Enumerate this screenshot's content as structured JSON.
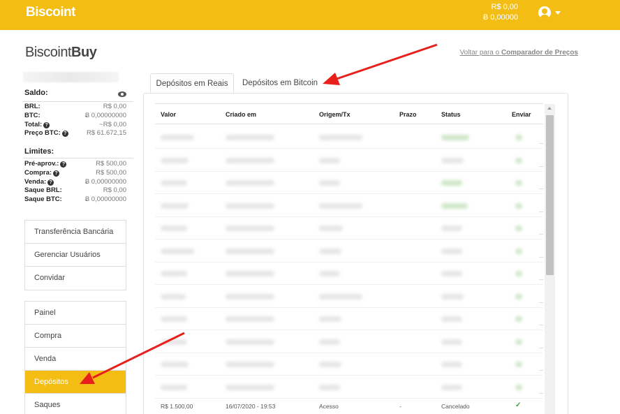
{
  "topbar": {
    "logo": "Biscoint",
    "balance_brl": "R$ 0,00",
    "balance_btc": "Ƀ 0,00000"
  },
  "header": {
    "brand_light": "Biscoint",
    "brand_bold": "Buy",
    "back_link_prefix": "Voltar para o ",
    "back_link_bold": "Comparador de Preços"
  },
  "sidebar": {
    "saldo_title": "Saldo:",
    "saldo": [
      {
        "label": "BRL:",
        "value": "R$ 0,00",
        "help": false
      },
      {
        "label": "BTC:",
        "value": "Ƀ 0,00000000",
        "help": false
      },
      {
        "label": "Total:",
        "value": "~R$ 0,00",
        "help": true
      },
      {
        "label": "Preço BTC:",
        "value": "R$ 61.672,15",
        "help": true
      }
    ],
    "limites_title": "Limites:",
    "limites": [
      {
        "label": "Pré-aprov.:",
        "value": "R$ 500,00",
        "help": true
      },
      {
        "label": "Compra:",
        "value": "R$ 500,00",
        "help": true
      },
      {
        "label": "Venda:",
        "value": "Ƀ 0,00000000",
        "help": true
      },
      {
        "label": "Saque BRL:",
        "value": "R$ 0,00",
        "help": false
      },
      {
        "label": "Saque BTC:",
        "value": "Ƀ 0,00000000",
        "help": false
      }
    ],
    "menu1": [
      "Transferência Bancária",
      "Gerenciar Usuários",
      "Convidar"
    ],
    "menu2": [
      "Painel",
      "Compra",
      "Venda",
      "Depósitos",
      "Saques"
    ],
    "active_item": "Depósitos"
  },
  "tabs": [
    "Depósitos em Reais",
    "Depósitos em Bitcoin"
  ],
  "table": {
    "columns": [
      "Valor",
      "Criado em",
      "Origem/Tx",
      "Prazo",
      "Status",
      "Enviar"
    ],
    "last_row": {
      "valor": "R$ 1.500,00",
      "criado_em": "16/07/2020 - 19:53",
      "origem": "Acesso",
      "prazo": "-",
      "status": "Cancelado",
      "enviar": "✓"
    }
  },
  "colors": {
    "accent": "#f3bd13",
    "arrow": "#e8201c"
  }
}
